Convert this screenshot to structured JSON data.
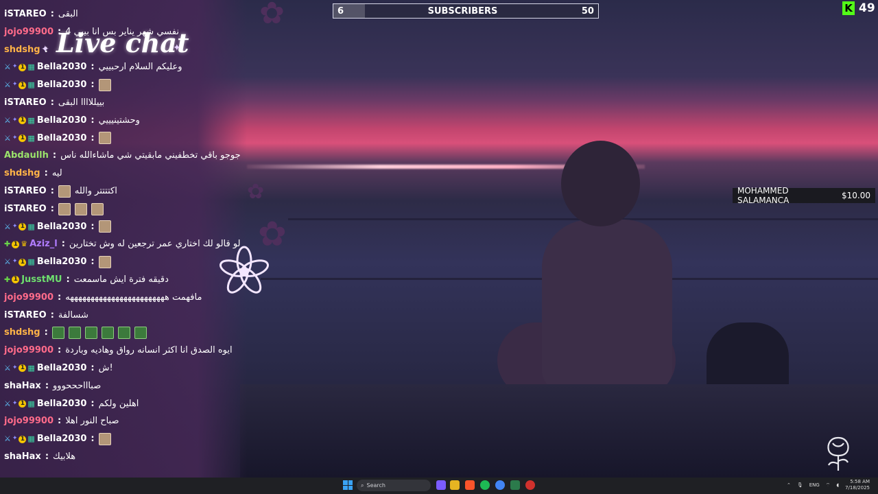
{
  "overlay": {
    "title": "Live chat",
    "goal": {
      "left": "6",
      "label": "SUBSCRIBERS",
      "right": "50",
      "progress": 0.12
    },
    "kick_count": "49",
    "donation": {
      "name": "MOHAMMED SALAMANCA",
      "amount": "$10.00"
    }
  },
  "chat": [
    {
      "badges": [],
      "user": "iSTAREO",
      "text": "البقى",
      "emotes": 0
    },
    {
      "badges": [],
      "user": "jojo99900",
      "text": "نفسي شهر يناير بس انا بيبي 4",
      "emotes": 0
    },
    {
      "badges": [],
      "user": "shdshg",
      "text": "",
      "emotes": 0
    },
    {
      "badges": [
        "sword",
        "star",
        "one",
        "grid"
      ],
      "user": "Bella2030",
      "text": "وعليكم السلام ارحبييي",
      "emotes": 0
    },
    {
      "badges": [
        "sword",
        "star",
        "one",
        "grid"
      ],
      "user": "Bella2030",
      "text": "",
      "emotes": 1
    },
    {
      "badges": [],
      "user": "iSTAREO",
      "text": "بييللاااا البقى",
      "emotes": 0
    },
    {
      "badges": [
        "sword",
        "star",
        "one",
        "grid"
      ],
      "user": "Bella2030",
      "text": "وحشتينيييي",
      "emotes": 0
    },
    {
      "badges": [
        "sword",
        "star",
        "one",
        "grid"
      ],
      "user": "Bella2030",
      "text": "",
      "emotes": 1
    },
    {
      "badges": [],
      "user": "Abdaullh",
      "text": "جوجو باقي تخطفيني مابقيتي شي ماشاءالله ناس",
      "emotes": 0
    },
    {
      "badges": [],
      "user": "shdshg",
      "text": "ليه",
      "emotes": 0
    },
    {
      "badges": [],
      "user": "iSTAREO",
      "text": "اكتتتتر والله",
      "emotes": 1
    },
    {
      "badges": [],
      "user": "iSTAREO",
      "text": "",
      "emotes": 3
    },
    {
      "badges": [
        "sword",
        "star",
        "one",
        "grid"
      ],
      "user": "Bella2030",
      "text": "",
      "emotes": 1
    },
    {
      "badges": [
        "diam",
        "one",
        "crown"
      ],
      "user": "Aziz_l",
      "text": "لو قالو لك اختاري عمر ترجعين له وش تختارين",
      "emotes": 0
    },
    {
      "badges": [
        "sword",
        "star",
        "one",
        "grid"
      ],
      "user": "Bella2030",
      "text": "",
      "emotes": 1
    },
    {
      "badges": [
        "diam",
        "one"
      ],
      "user": "JusstMU",
      "text": "دقيقه فترة ايش ماسمعت",
      "emotes": 0
    },
    {
      "badges": [],
      "user": "jojo99900",
      "text": "مافهمت ههههههههههههههههههههههههه",
      "emotes": 0
    },
    {
      "badges": [],
      "user": "iSTAREO",
      "text": "شسالفة",
      "emotes": 0
    },
    {
      "badges": [],
      "user": "shdshg",
      "text": "",
      "emotes": 6
    },
    {
      "badges": [],
      "user": "jojo99900",
      "text": "ايوه الصدق انا اكثر انسانه رواق وهاديه وباردة",
      "emotes": 0
    },
    {
      "badges": [
        "sword",
        "star",
        "one",
        "grid"
      ],
      "user": "Bella2030",
      "text": "ش!",
      "emotes": 0
    },
    {
      "badges": [],
      "user": "shaHax",
      "text": "صباااحححووو",
      "emotes": 0
    },
    {
      "badges": [
        "sword",
        "star",
        "one",
        "grid"
      ],
      "user": "Bella2030",
      "text": "اهلين ولكم",
      "emotes": 0
    },
    {
      "badges": [],
      "user": "jojo99900",
      "text": "صباح النور اهلا",
      "emotes": 0
    },
    {
      "badges": [
        "sword",
        "star",
        "one",
        "grid"
      ],
      "user": "Bella2030",
      "text": "",
      "emotes": 1
    },
    {
      "badges": [],
      "user": "shaHax",
      "text": "هلابيك",
      "emotes": 0
    }
  ],
  "user_colors": {
    "iSTAREO": "#ffffff",
    "jojo99900": "#ff6b8a",
    "shdshg": "#ffb347",
    "Bella2030": "#ffffff",
    "Abdaullh": "#9be36b",
    "Aziz_l": "#b07cff",
    "JusstMU": "#6ee06e",
    "shaHax": "#ffffff"
  },
  "taskbar": {
    "search_placeholder": "Search",
    "lang": "ENG",
    "time": "5:58 AM",
    "date": "7/18/2025"
  }
}
